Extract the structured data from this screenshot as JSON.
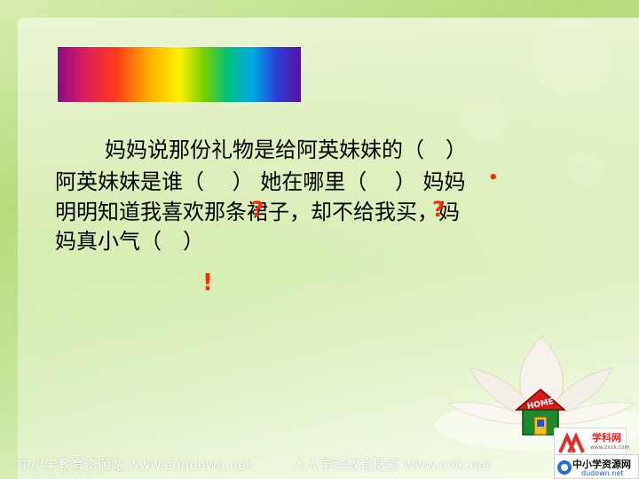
{
  "slide": {
    "paragraph": [
      "妈妈说那份礼物是给阿英妹妹的（　）",
      "阿英妹妹是谁（　 ）  她在哪里（　 ）  妈妈",
      "明明知道我喜欢那条裙子，却不给我买，妈",
      "妈真小气（　）"
    ],
    "marks": {
      "question1": "?",
      "question2": "?",
      "dot": "•",
      "exclaim": "!"
    }
  },
  "home": {
    "label": "HOME"
  },
  "footer": {
    "left": "中小学教育资源站 www.edudown.net",
    "right": "人人学科教育搜索  www.rrxk.net"
  },
  "logos": {
    "logo1_text": "学科网",
    "logo1_sub": "www.zxxk.com",
    "logo2_text": "中小学资源网",
    "logo2_sub": "dudown.net"
  },
  "colors": {
    "background": "#c6e59a",
    "punctuation_mark": "#ff2a00",
    "text": "#000000"
  }
}
